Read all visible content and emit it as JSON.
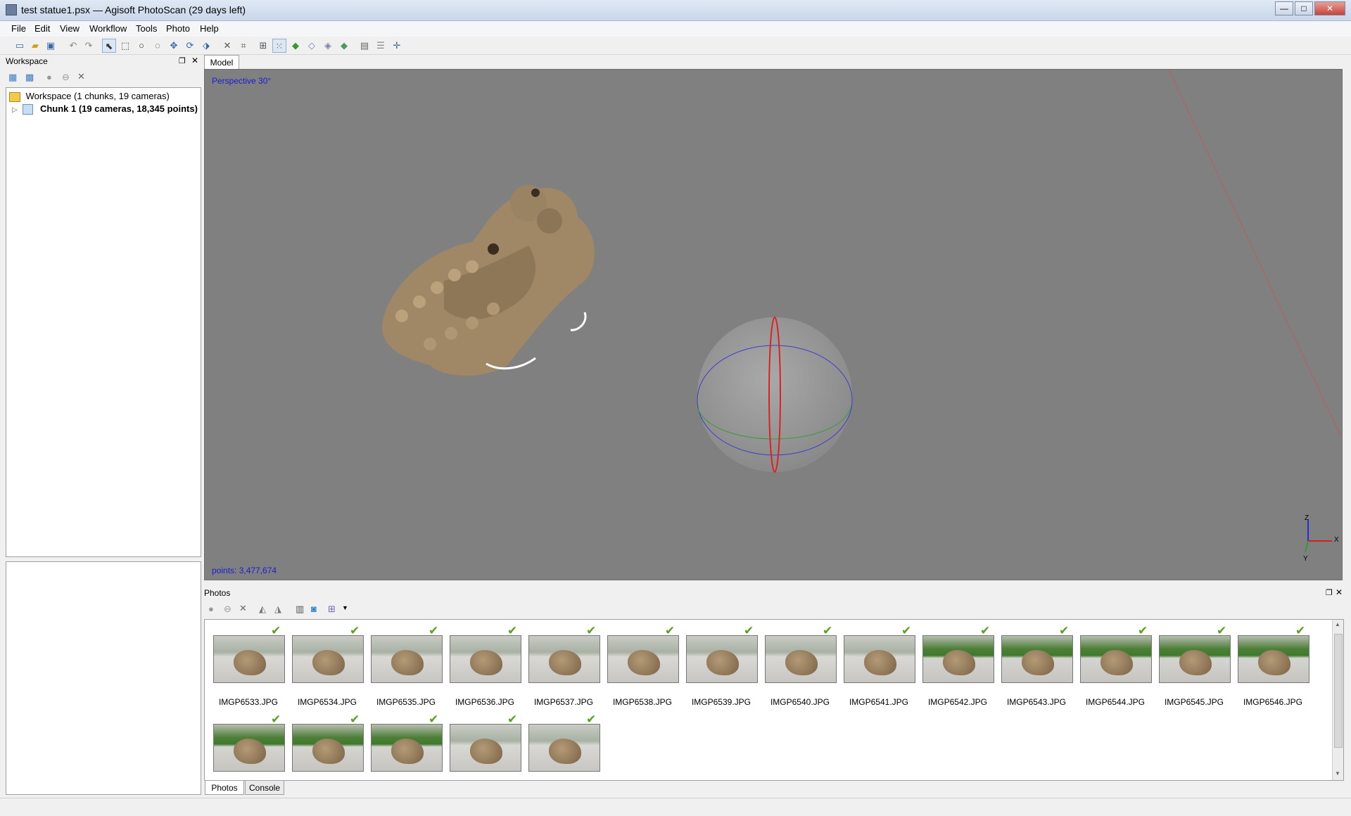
{
  "window": {
    "title": "test statue1.psx — Agisoft PhotoScan (29 days left)",
    "min_label": "—",
    "max_label": "□",
    "close_label": "✕"
  },
  "menu": [
    "File",
    "Edit",
    "View",
    "Workflow",
    "Tools",
    "Photo",
    "Help"
  ],
  "toolbar_icons": [
    "new-icon",
    "open-icon",
    "save-icon",
    "undo-icon",
    "redo-icon",
    "select-icon",
    "rect-select-icon",
    "circle-select-icon",
    "free-select-icon",
    "move-object-icon",
    "rotate-object-icon",
    "scale-object-icon",
    "delete-icon",
    "crop-icon",
    "thumbnails-icon",
    "point-cloud-icon",
    "solid-icon",
    "wireframe-icon",
    "shaded-icon",
    "textured-icon",
    "camera-icon",
    "show-cameras-icon",
    "reset-view-icon"
  ],
  "workspace": {
    "title": "Workspace",
    "root_label": "Workspace (1 chunks, 19 cameras)",
    "chunk_label": "Chunk 1 (19 cameras, 18,345 points)"
  },
  "model": {
    "tab_label": "Model",
    "projection": "Perspective 30°",
    "points": "points: 3,477,674",
    "axes": {
      "z": "Z",
      "x": "X",
      "y": "Y"
    }
  },
  "photos": {
    "title": "Photos",
    "items": [
      {
        "name": "IMGP6533.JPG",
        "grass": false
      },
      {
        "name": "IMGP6534.JPG",
        "grass": false
      },
      {
        "name": "IMGP6535.JPG",
        "grass": false
      },
      {
        "name": "IMGP6536.JPG",
        "grass": false
      },
      {
        "name": "IMGP6537.JPG",
        "grass": false
      },
      {
        "name": "IMGP6538.JPG",
        "grass": false
      },
      {
        "name": "IMGP6539.JPG",
        "grass": false
      },
      {
        "name": "IMGP6540.JPG",
        "grass": false
      },
      {
        "name": "IMGP6541.JPG",
        "grass": false
      },
      {
        "name": "IMGP6542.JPG",
        "grass": true
      },
      {
        "name": "IMGP6543.JPG",
        "grass": true
      },
      {
        "name": "IMGP6544.JPG",
        "grass": true
      },
      {
        "name": "IMGP6545.JPG",
        "grass": true
      },
      {
        "name": "IMGP6546.JPG",
        "grass": true
      },
      {
        "name": "",
        "grass": true
      },
      {
        "name": "",
        "grass": true
      },
      {
        "name": "",
        "grass": true
      },
      {
        "name": "",
        "grass": false
      },
      {
        "name": "",
        "grass": false
      }
    ]
  },
  "bottom_tabs": {
    "photos": "Photos",
    "console": "Console"
  },
  "colors": {
    "accent": "#1b1bd6",
    "viewport": "#808080",
    "check": "#5aa01e",
    "axis_red": "#e02020"
  }
}
